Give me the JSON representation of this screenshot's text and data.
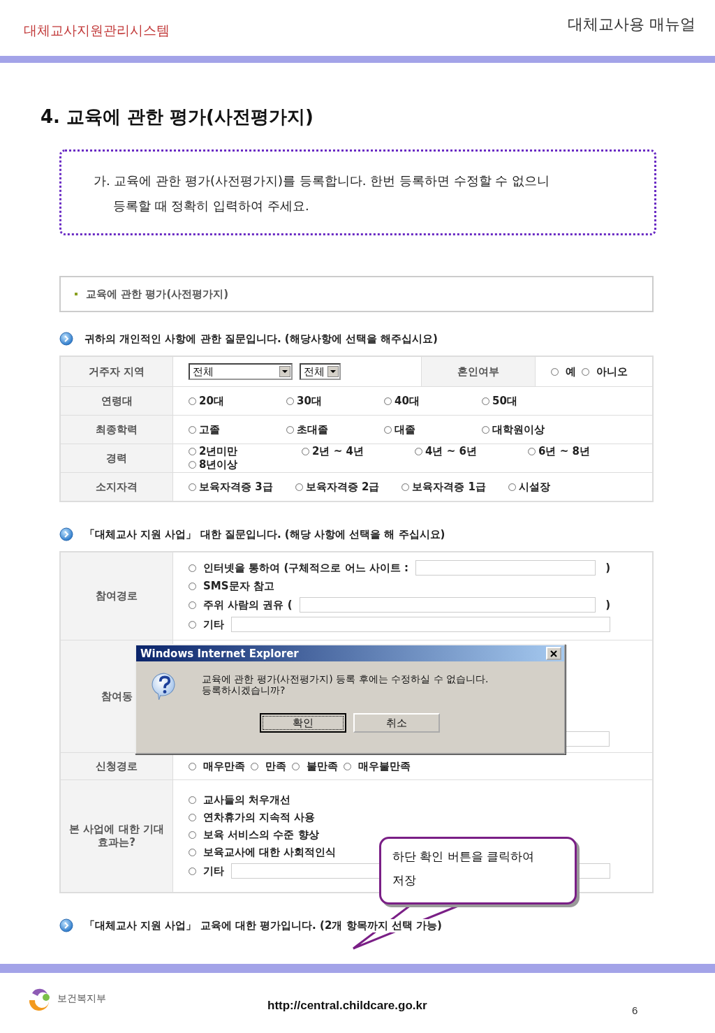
{
  "header": {
    "system_name": "대체교사지원관리시스템",
    "manual_name": "대체교사용 매뉴얼"
  },
  "title": "4. 교육에 관한 평가(사전평가지)",
  "notice": {
    "text": "가. 교육에 관한 평가(사전평가지)를 등록합니다. 한번 등록하면 수정할 수 없으니 등록할 때 정확히 입력하여 주세요."
  },
  "form": {
    "panel_title": "교육에 관한 평가(사전평가지)",
    "sections": [
      {
        "heading": "귀하의 개인적인 사항에 관한 질문입니다. (해당사항에 선택을 해주십시요)",
        "rows": [
          {
            "kind": "region",
            "label": "거주자 지역",
            "selects": [
              "전체",
              "전체"
            ],
            "label_2": "혼인여부",
            "options": [
              {
                "label": "예",
                "selected": false
              },
              {
                "label": "아니오",
                "selected": false
              }
            ]
          },
          {
            "kind": "columns",
            "label": "연령대",
            "options": [
              {
                "label": "20대",
                "selected": false
              },
              {
                "label": "30대",
                "selected": false
              },
              {
                "label": "40대",
                "selected": false
              },
              {
                "label": "50대",
                "selected": false
              }
            ]
          },
          {
            "kind": "columns",
            "label": "최종학력",
            "options": [
              {
                "label": "고졸",
                "selected": false
              },
              {
                "label": "초대졸",
                "selected": false
              },
              {
                "label": "대졸",
                "selected": false
              },
              {
                "label": "대학원이상",
                "selected": false
              }
            ]
          },
          {
            "kind": "columns",
            "label": "경력",
            "options": [
              {
                "label": "2년미만",
                "selected": false
              },
              {
                "label": "2년 ~ 4년",
                "selected": false
              },
              {
                "label": "4년 ~ 6년",
                "selected": false
              },
              {
                "label": "6년 ~ 8년",
                "selected": false
              },
              {
                "label": "8년이상",
                "selected": false
              }
            ]
          },
          {
            "kind": "wide",
            "label": "소지자격",
            "options": [
              {
                "label": "보육자격증 3급",
                "selected": false
              },
              {
                "label": "보육자격증 2급",
                "selected": false
              },
              {
                "label": "보육자격증 1급",
                "selected": false
              },
              {
                "label": "시설장",
                "selected": false
              }
            ]
          }
        ]
      },
      {
        "heading": "「대체교사 지원 사업」 대한 질문입니다. (해당 사항에 선택을 해 주십시요)",
        "rows": [
          {
            "kind": "stack",
            "label": "참여경로",
            "options": [
              {
                "label": "인터넷을 통하여 (구체적으로 어느 사이트 :",
                "selected": false,
                "field": true,
                "suffix": ")"
              },
              {
                "label": "SMS문자 참고",
                "selected": false
              },
              {
                "label": "주위 사람의 권유 (",
                "selected": false,
                "field": true,
                "suffix": ")"
              },
              {
                "label": "기타",
                "selected": false,
                "field": true
              }
            ]
          },
          {
            "kind": "covered",
            "label": "참여동"
          },
          {
            "kind": "inline",
            "label": "신청경로",
            "options": [
              {
                "label": "매우만족",
                "selected": false
              },
              {
                "label": "만족",
                "selected": false
              },
              {
                "label": "불만족",
                "selected": false
              },
              {
                "label": "매우불만족",
                "selected": false
              }
            ]
          },
          {
            "kind": "stack",
            "label": "본 사업에 대한 기대 효과는?",
            "options": [
              {
                "label": "교사들의 처우개선",
                "selected": false
              },
              {
                "label": "연차휴가의 지속적 사용",
                "selected": false
              },
              {
                "label": "보육 서비스의 수준 향상",
                "selected": false
              },
              {
                "label": "보육교사에 대한 사회적인식",
                "selected": false
              },
              {
                "label": "기타",
                "selected": false,
                "field": true
              }
            ]
          }
        ]
      },
      {
        "heading": "「대체교사 지원 사업」 교육에 대한 평가입니다. (2개 항목까지 선택 가능)"
      }
    ]
  },
  "dialog": {
    "title": "Windows Internet Explorer",
    "message": [
      "교육에 관한 평가(사전평가지) 등록 후에는 수정하실 수 없습니다.",
      "등록하시겠습니까?"
    ],
    "buttons": [
      {
        "label": "확인",
        "focused": true
      },
      {
        "label": "취소",
        "focused": false
      }
    ]
  },
  "callout": {
    "text": "하단 확인 버튼을 클릭하여 저장"
  },
  "footer": {
    "ministry": "보건복지부",
    "url": "http://central.childcare.go.kr",
    "page": "6"
  }
}
